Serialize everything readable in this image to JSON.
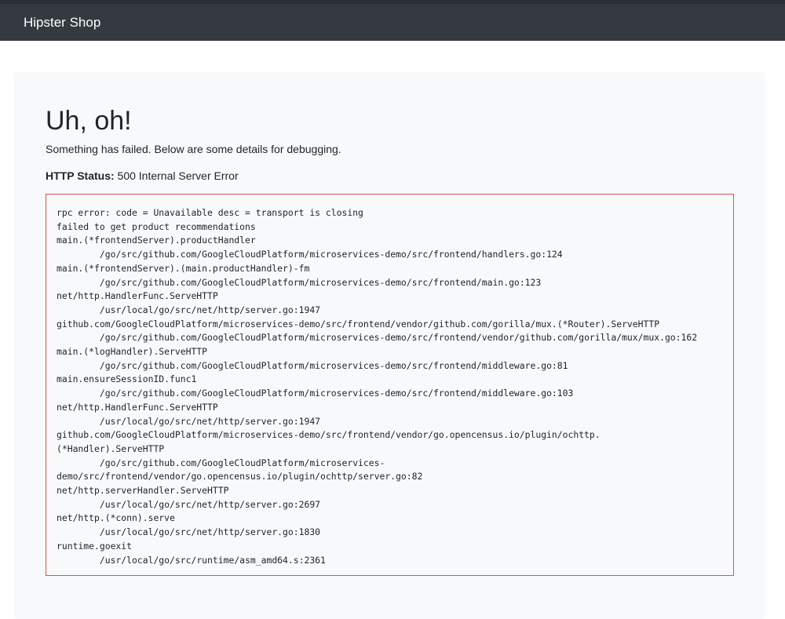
{
  "header": {
    "brand": "Hipster Shop"
  },
  "error": {
    "title": "Uh, oh!",
    "message": "Something has failed. Below are some details for debugging.",
    "status_label": "HTTP Status:",
    "status_value": "500 Internal Server Error",
    "trace": "rpc error: code = Unavailable desc = transport is closing\nfailed to get product recommendations\nmain.(*frontendServer).productHandler\n\t/go/src/github.com/GoogleCloudPlatform/microservices-demo/src/frontend/handlers.go:124\nmain.(*frontendServer).(main.productHandler)-fm\n\t/go/src/github.com/GoogleCloudPlatform/microservices-demo/src/frontend/main.go:123\nnet/http.HandlerFunc.ServeHTTP\n\t/usr/local/go/src/net/http/server.go:1947\ngithub.com/GoogleCloudPlatform/microservices-demo/src/frontend/vendor/github.com/gorilla/mux.(*Router).ServeHTTP\n\t/go/src/github.com/GoogleCloudPlatform/microservices-demo/src/frontend/vendor/github.com/gorilla/mux/mux.go:162\nmain.(*logHandler).ServeHTTP\n\t/go/src/github.com/GoogleCloudPlatform/microservices-demo/src/frontend/middleware.go:81\nmain.ensureSessionID.func1\n\t/go/src/github.com/GoogleCloudPlatform/microservices-demo/src/frontend/middleware.go:103\nnet/http.HandlerFunc.ServeHTTP\n\t/usr/local/go/src/net/http/server.go:1947\ngithub.com/GoogleCloudPlatform/microservices-demo/src/frontend/vendor/go.opencensus.io/plugin/ochttp.\n(*Handler).ServeHTTP\n\t/go/src/github.com/GoogleCloudPlatform/microservices-\ndemo/src/frontend/vendor/go.opencensus.io/plugin/ochttp/server.go:82\nnet/http.serverHandler.ServeHTTP\n\t/usr/local/go/src/net/http/server.go:2697\nnet/http.(*conn).serve\n\t/usr/local/go/src/net/http/server.go:1830\nruntime.goexit\n\t/usr/local/go/src/runtime/asm_amd64.s:2361"
  }
}
